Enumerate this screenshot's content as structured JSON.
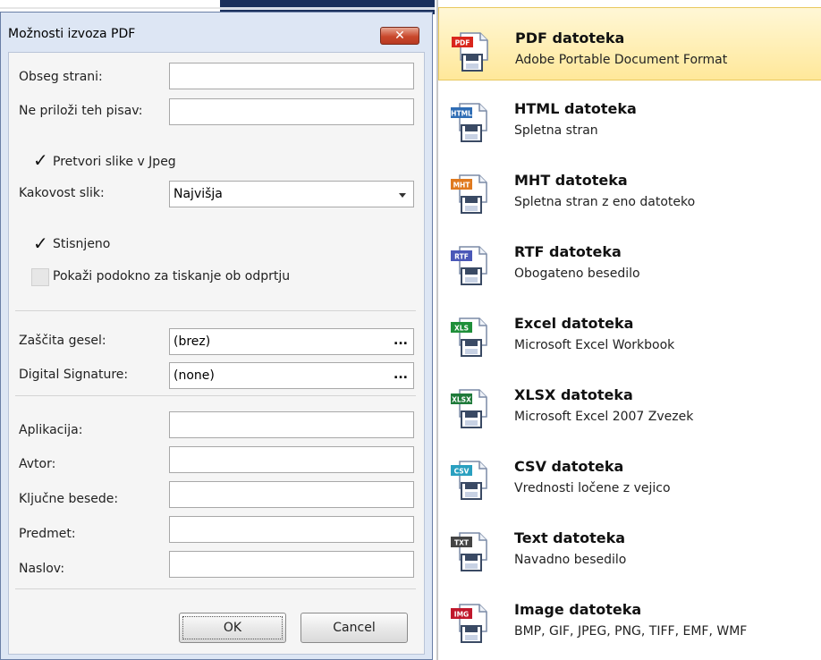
{
  "dialog": {
    "title": "Možnosti izvoza PDF",
    "close_label": "✕",
    "fields": {
      "page_range_label": "Obseg strani:",
      "page_range_value": "",
      "exclude_fonts_label": "Ne priloži teh pisav:",
      "exclude_fonts_value": "",
      "convert_jpeg_label": "Pretvori slike v Jpeg",
      "image_quality_label": "Kakovost slik:",
      "image_quality_value": "Najvišja",
      "compressed_label": "Stisnjeno",
      "show_print_label": "Pokaži podokno za tiskanje ob odprtju",
      "password_label": "Zaščita gesel:",
      "password_value": "(brez)",
      "signature_label": "Digital Signature:",
      "signature_value": "(none)",
      "dots": "...",
      "application_label": "Aplikacija:",
      "author_label": "Avtor:",
      "keywords_label": "Ključne besede:",
      "subject_label": "Predmet:",
      "title_label": "Naslov:"
    },
    "ok_label": "OK",
    "cancel_label": "Cancel"
  },
  "menu": {
    "items": [
      {
        "badge": "PDF",
        "badge_color": "#d9261c",
        "title": "PDF datoteka",
        "desc": "Adobe Portable Document Format",
        "active": true
      },
      {
        "badge": "HTML",
        "badge_color": "#2f6db5",
        "title": "HTML datoteka",
        "desc": "Spletna stran",
        "active": false
      },
      {
        "badge": "MHT",
        "badge_color": "#e07a1f",
        "title": "MHT datoteka",
        "desc": "Spletna stran z eno datoteko",
        "active": false
      },
      {
        "badge": "RTF",
        "badge_color": "#4a58b8",
        "title": "RTF datoteka",
        "desc": "Obogateno besedilo",
        "active": false
      },
      {
        "badge": "XLS",
        "badge_color": "#1f8f3a",
        "title": "Excel datoteka",
        "desc": "Microsoft Excel Workbook",
        "active": false
      },
      {
        "badge": "XLSX",
        "badge_color": "#1f7a3a",
        "title": "XLSX datoteka",
        "desc": "Microsoft Excel 2007 Zvezek",
        "active": false
      },
      {
        "badge": "CSV",
        "badge_color": "#2aa0c0",
        "title": "CSV datoteka",
        "desc": "Vrednosti ločene z vejico",
        "active": false
      },
      {
        "badge": "TXT",
        "badge_color": "#444444",
        "title": "Text datoteka",
        "desc": "Navadno besedilo",
        "active": false
      },
      {
        "badge": "IMG",
        "badge_color": "#c0182c",
        "title": "Image datoteka",
        "desc": "BMP, GIF, JPEG, PNG, TIFF, EMF, WMF",
        "active": false
      }
    ]
  }
}
